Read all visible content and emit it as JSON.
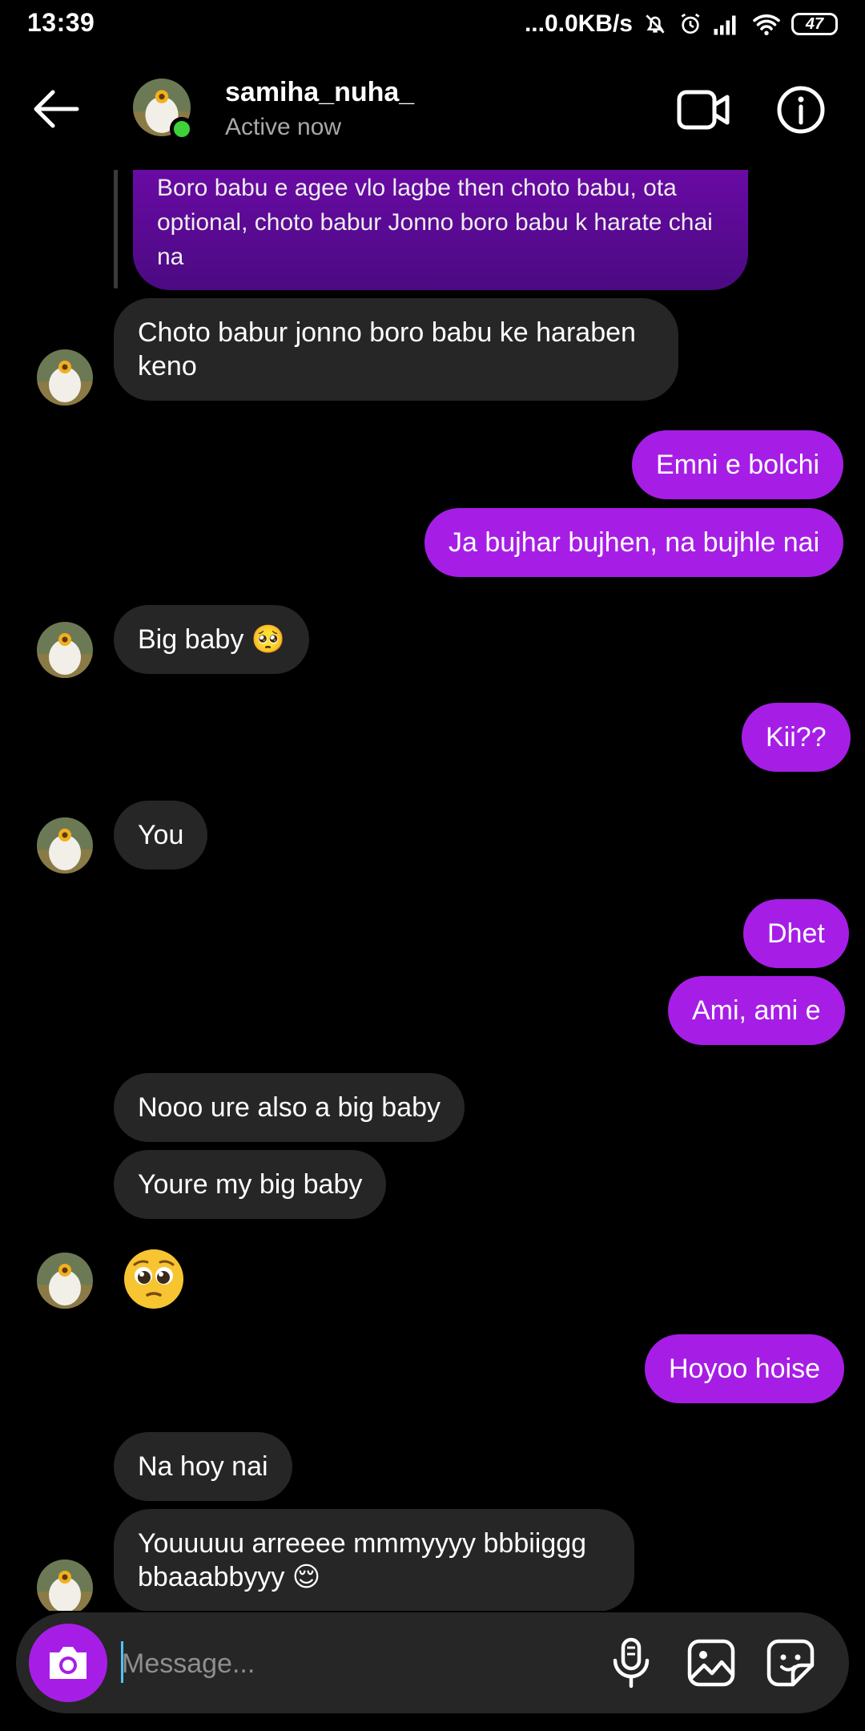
{
  "status_bar": {
    "time": "13:39",
    "net_speed": "...0.0KB/s",
    "battery": "47"
  },
  "header": {
    "username": "samiha_nuha_",
    "status": "Active now",
    "icons": [
      "back-arrow-icon",
      "video-call-icon",
      "info-icon"
    ]
  },
  "messages": {
    "quoted": "Boro babu e agee vlo lagbe then choto babu, ota optional, choto babur Jonno boro babu k harate chai na",
    "m1": "Choto babur jonno boro babu ke haraben keno",
    "m2": "Emni e bolchi",
    "m3": "Ja bujhar bujhen, na bujhle nai",
    "m4": "Big baby 🥺",
    "m5": "Kii??",
    "m6": "You",
    "m7": "Dhet",
    "m8": "Ami, ami e",
    "m9": "Nooo ure also a big baby",
    "m10": "Youre my big baby",
    "m11": "🥺",
    "m12": "Hoyoo hoise",
    "m13": "Na hoy nai",
    "m14": "Youuuuu arreeee mmmyyyy bbbiiggg bbaaabbyyy 😌"
  },
  "composer": {
    "placeholder": "Message...",
    "icons": [
      "camera-icon",
      "microphone-icon",
      "gallery-icon",
      "sticker-icon"
    ]
  },
  "colors": {
    "background": "#000000",
    "incoming_bubble": "#262626",
    "outgoing_bubble": "#a61ee6",
    "online": "#3fd13a"
  }
}
